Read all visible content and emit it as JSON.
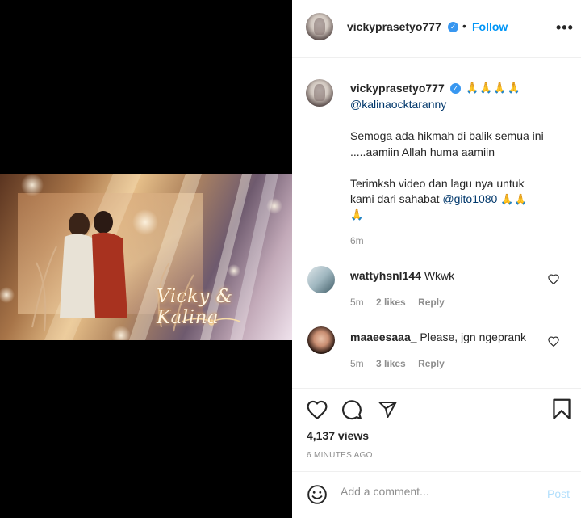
{
  "post": {
    "video_title": "Vicky & Kalina",
    "author": "vickyprasetyo777",
    "separator": "•",
    "follow_label": "Follow",
    "more_label": "•••",
    "caption": {
      "emoji_line": "🙏🙏🙏🙏",
      "mention_line": "@kalinaocktaranny",
      "para1_line1": "Semoga ada hikmah di balik semua ini",
      "para1_line2": ".....aamiin Allah huma aamiin",
      "para2_line1": "Terimksh video dan lagu nya untuk",
      "para2_line2_text": "kami dari sahabat ",
      "para2_line2_mention": "@gito1080",
      "para2_line2_emoji": "🙏🙏",
      "para2_line3_emoji": "🙏",
      "time": "6m"
    }
  },
  "comments": [
    {
      "user": "wattyhsnl144",
      "text": "Wkwk",
      "time": "5m",
      "likes": "2 likes",
      "reply": "Reply"
    },
    {
      "user": "maaeesaaa_",
      "text": "Please, jgn ngeprank",
      "time": "5m",
      "likes": "3 likes",
      "reply": "Reply"
    }
  ],
  "stats": {
    "views": "4,137 views",
    "posted": "6 MINUTES AGO"
  },
  "comment_box": {
    "placeholder": "Add a comment...",
    "post_label": "Post"
  },
  "colors": {
    "accent": "#0095f6",
    "verified": "#3897f0",
    "mention": "#00376b",
    "muted": "#8e8e8e",
    "post_disabled": "#b2dffc"
  },
  "icons": [
    "verified-badge-icon",
    "more-options-icon",
    "heart-icon",
    "comment-icon",
    "share-icon",
    "bookmark-icon",
    "emoji-icon"
  ]
}
